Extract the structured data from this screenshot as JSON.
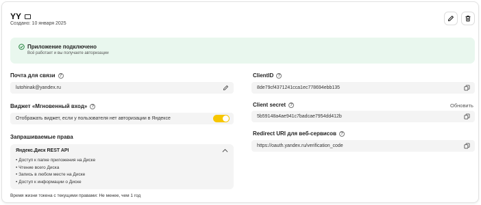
{
  "app": {
    "title": "YY",
    "created": "Создано: 10 января 2025"
  },
  "status": {
    "title": "Приложение подключено",
    "subtitle": "Всё работает и вы получаете авторизации",
    "color": "#e9f7ee"
  },
  "contact": {
    "label": "Почта для связи",
    "value": "lutohinak@yandex.ru"
  },
  "widget": {
    "label": "Виджет «Мгновенный вход»",
    "toggle_text": "Отображать виджет, если у пользователя нет авторизации в Яндексе",
    "enabled": true,
    "accent": "#f7c600"
  },
  "permissions": {
    "label": "Запрашиваемые права",
    "group_title": "Яндекс.Диск REST API",
    "items": [
      "Доступ к папке приложения на Диске",
      "Чтение всего Диска",
      "Запись в любом месте на Диске",
      "Доступ к информации о Диске"
    ],
    "lifetime": "Время жизни токена с текущими правами: Не менее, чем 1 год"
  },
  "client_id": {
    "label": "ClientID",
    "value": "8de79cf4371241cca1ec778694ebb135"
  },
  "client_secret": {
    "label": "Client secret",
    "value": "5b59148a4ae941c7badcae7954dd412b",
    "action": "Обновить"
  },
  "redirect": {
    "label": "Redirect URI для веб-сервисов",
    "value": "https://oauth.yandex.ru/verification_code"
  }
}
